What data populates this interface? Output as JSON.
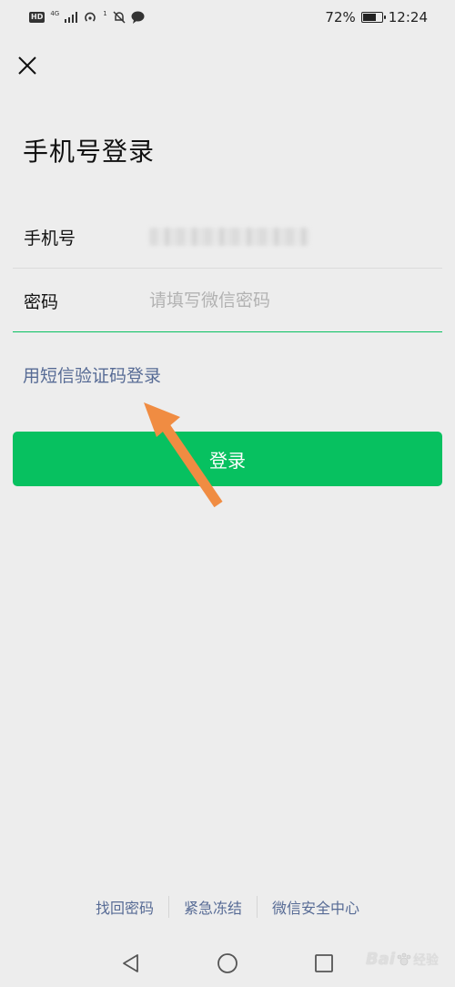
{
  "status_bar": {
    "hd_label": "HD",
    "network_label": "4G",
    "notification_count": "1",
    "battery_percent": "72%",
    "battery_level": 0.72,
    "time": "12:24",
    "icons": [
      "hd-icon",
      "signal-icon",
      "hotspot-icon",
      "mute-bell-icon",
      "chat-icon",
      "battery-icon"
    ]
  },
  "header": {
    "close_icon": "close-icon",
    "title": "手机号登录"
  },
  "form": {
    "phone_label": "手机号",
    "password_label": "密码",
    "password_placeholder": "请填写微信密码"
  },
  "sms_login_link": "用短信验证码登录",
  "login_button": "登录",
  "footer": {
    "links": [
      "找回密码",
      "紧急冻结",
      "微信安全中心"
    ]
  },
  "nav": {
    "icons": [
      "back-icon",
      "home-icon",
      "recent-apps-icon"
    ]
  },
  "watermark": {
    "brand": "Bai",
    "sub": "经验"
  },
  "colors": {
    "background": "#ededed",
    "accent": "#07c160",
    "link": "#576b95",
    "annotation_arrow": "#f08c42"
  }
}
